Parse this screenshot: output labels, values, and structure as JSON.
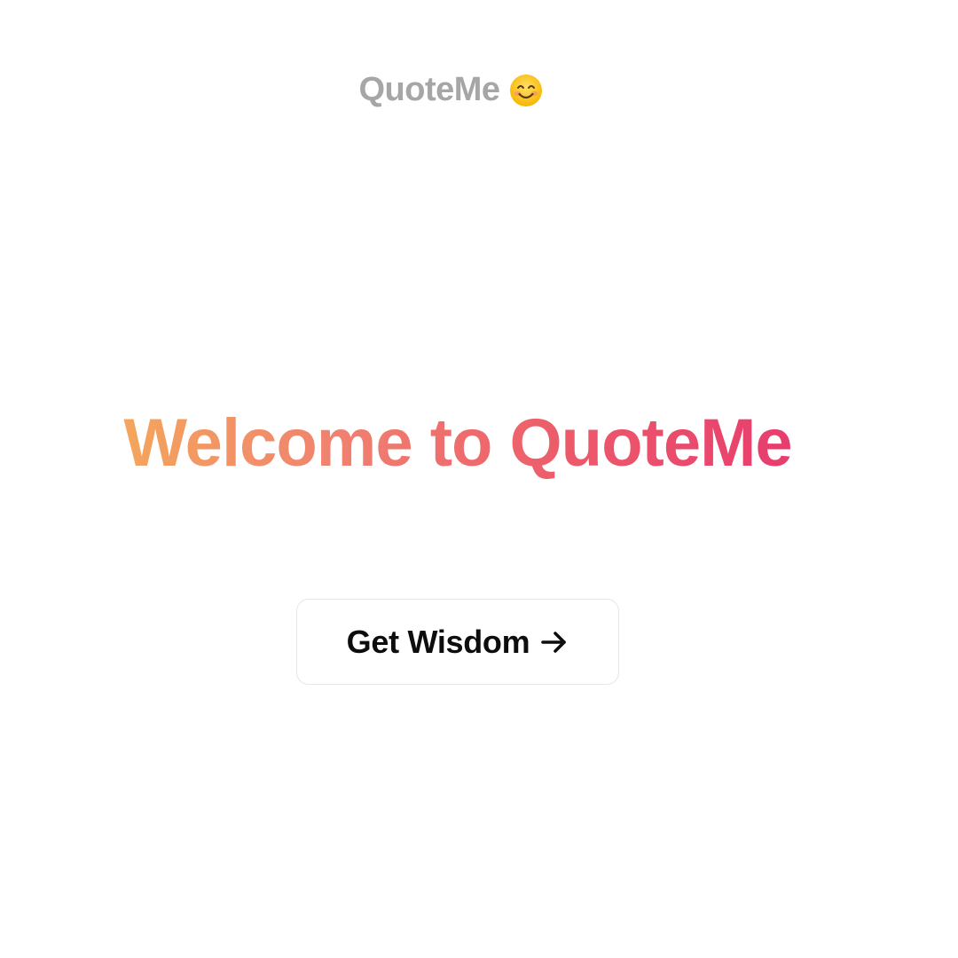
{
  "header": {
    "brand_name": "QuoteMe",
    "brand_icon": "smiling-face-emoji-icon"
  },
  "hero": {
    "title": "Welcome to QuoteMe",
    "gradient_colors": [
      "#f4a55c",
      "#f08070",
      "#ec5a6a",
      "#e83c6e"
    ]
  },
  "cta": {
    "label": "Get Wisdom",
    "icon": "arrow-right-icon"
  }
}
